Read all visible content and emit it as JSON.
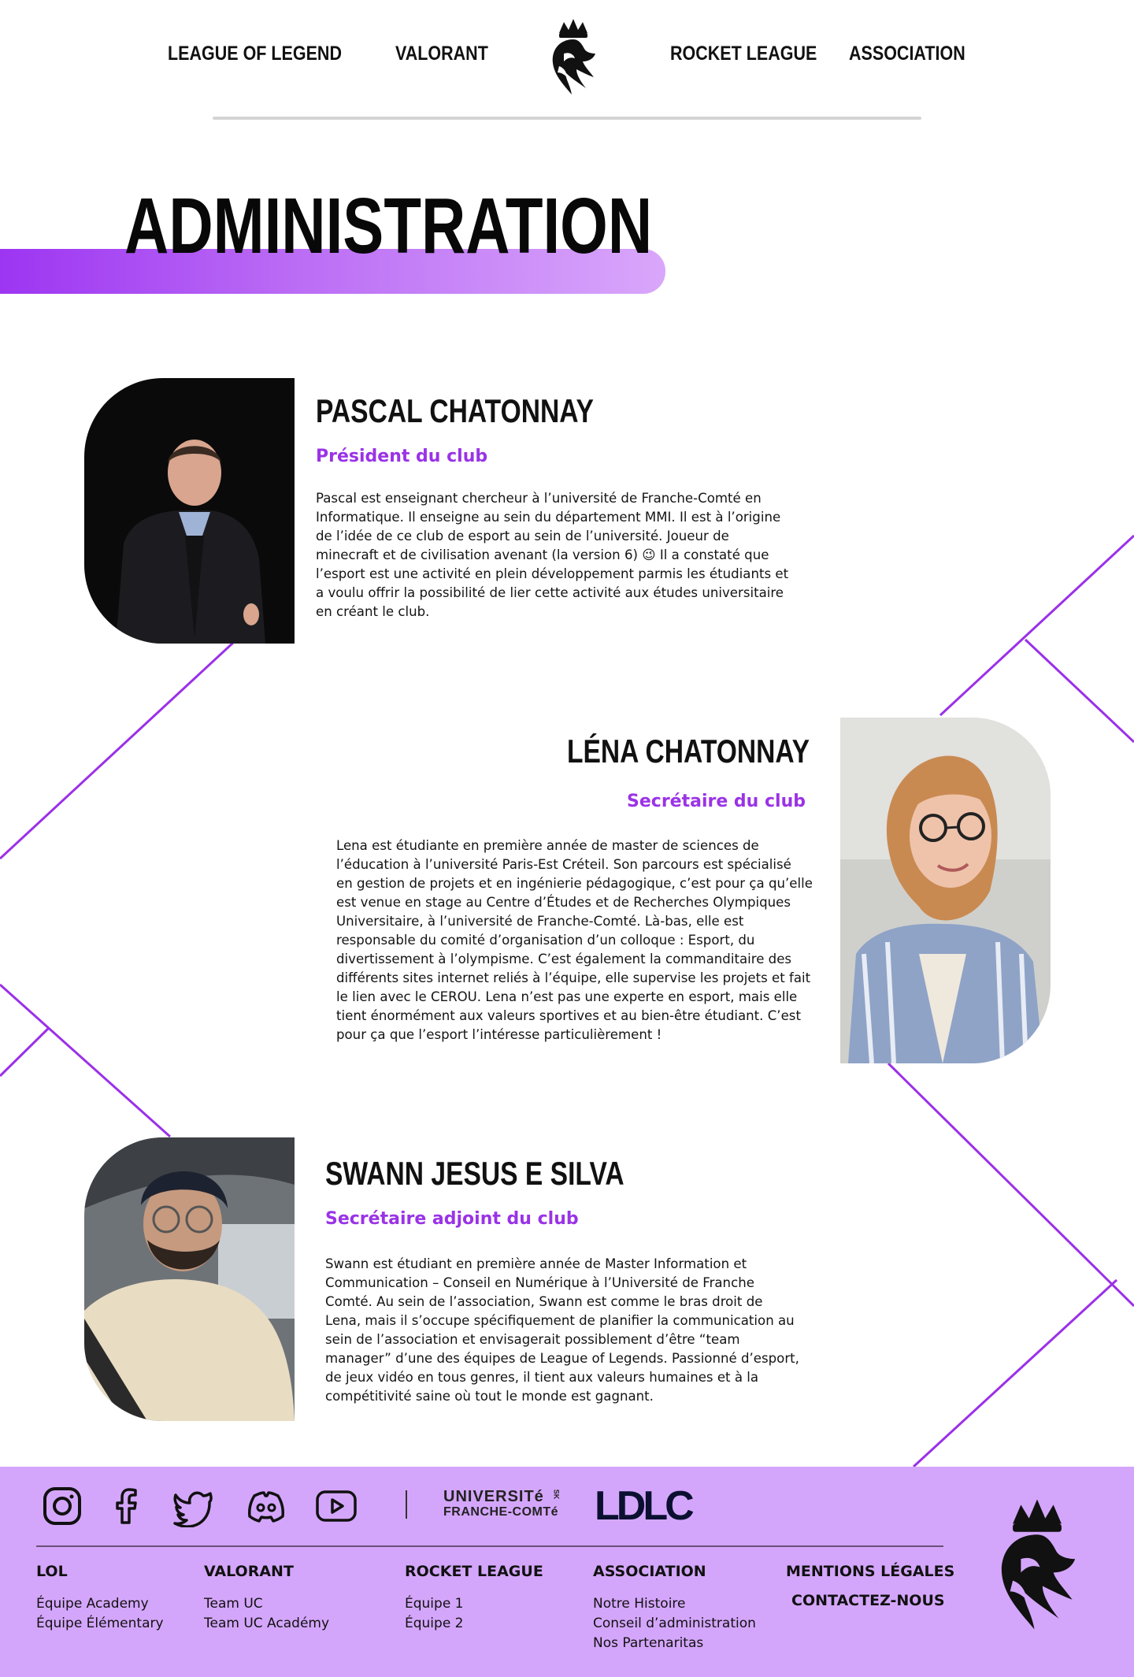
{
  "nav": {
    "lol": "LEAGUE OF LEGEND",
    "valorant": "VALORANT",
    "rocket": "ROCKET LEAGUE",
    "association": "ASSOCIATION"
  },
  "page": {
    "title": "ADMINISTRATION"
  },
  "members": [
    {
      "name": "PASCAL CHATONNAY",
      "role": "Président du club",
      "bio_lines": [
        "Pascal est enseignant chercheur à l’université de Franche-Comté en",
        "Informatique. Il enseigne au sein du département MMI. Il est à l’origine",
        "de l’idée de ce club de esport au sein de l’université. Joueur de",
        "minecraft et de civilisation avenant (la version 6) 😉 Il a constaté que",
        "l’esport est une activité en plein développement parmis les étudiants et",
        "a voulu offrir la possibilité de lier cette activité aux études universitaire",
        "en créant le club."
      ]
    },
    {
      "name": "LÉNA CHATONNAY",
      "role": "Secrétaire du club",
      "bio_lines": [
        "Lena est étudiante en première année de master de sciences de",
        "l’éducation à l’université Paris-Est Créteil. Son parcours est spécialisé",
        "en gestion de projets et en ingénierie pédagogique, c’est pour ça qu’elle",
        "est venue en stage au Centre d’Études et de Recherches Olympiques",
        "Universitaire, à l’université de Franche-Comté. Là-bas, elle est",
        "responsable du comité d’organisation d’un colloque : Esport, du",
        "divertissement à l’olympisme. C’est également la commanditaire des",
        "différents sites internet reliés à l’équipe, elle supervise les projets et fait",
        "le lien avec le CEROU. Lena n’est pas une experte en esport, mais elle",
        "tient énormément aux valeurs sportives et au bien-être étudiant. C’est",
        "pour ça que l’esport l’intéresse particulièrement !"
      ]
    },
    {
      "name": "SWANN JESUS E SILVA",
      "role": "Secrétaire adjoint du club",
      "bio_lines": [
        "Swann est étudiant en première année de Master Information et",
        "Communication – Conseil en Numérique à l’Université de Franche",
        "Comté. Au sein de l’association, Swann est comme le bras droit de",
        "Lena, mais il s’occupe spécifiquement de planifier la communication au",
        "sein de l’association et envisagerait possiblement d’être “team",
        "manager” d’une des équipes de League of Legends. Passionné d’esport,",
        "de jeux vidéo en tous genres, il tient aux valeurs humaines et à la",
        "compétitivité saine où tout le monde est gagnant."
      ]
    }
  ],
  "footer": {
    "social_icons": [
      "instagram-icon",
      "facebook-icon",
      "twitter-icon",
      "discord-icon",
      "youtube-icon"
    ],
    "partners": {
      "ufc_line1": "UNIVERSITé",
      "ufc_line2": "FRANCHE-COMTé",
      "ufc_tag": "SK",
      "ldlc": "LDLC"
    },
    "columns": {
      "lol": {
        "title": "LOL",
        "items": [
          "Équipe Academy",
          "Équipe Élémentary"
        ]
      },
      "valorant": {
        "title": "VALORANT",
        "items": [
          "Team UC",
          "Team UC Académy"
        ]
      },
      "rocket": {
        "title": "ROCKET LEAGUE",
        "items": [
          "Équipe 1",
          "Équipe 2"
        ]
      },
      "association": {
        "title": "ASSOCIATION",
        "items": [
          "Notre Histoire",
          "Conseil d’administration",
          "Nos Partenaritas"
        ]
      },
      "legal": {
        "title": "MENTIONS LÉGALES",
        "contact": "CONTACTEZ-NOUS"
      }
    }
  },
  "colors": {
    "accent": "#9a33e6",
    "footer_bg": "#d4a6fb",
    "title_bar_start": "#9d35f2",
    "title_bar_end": "#d9a7fb"
  }
}
